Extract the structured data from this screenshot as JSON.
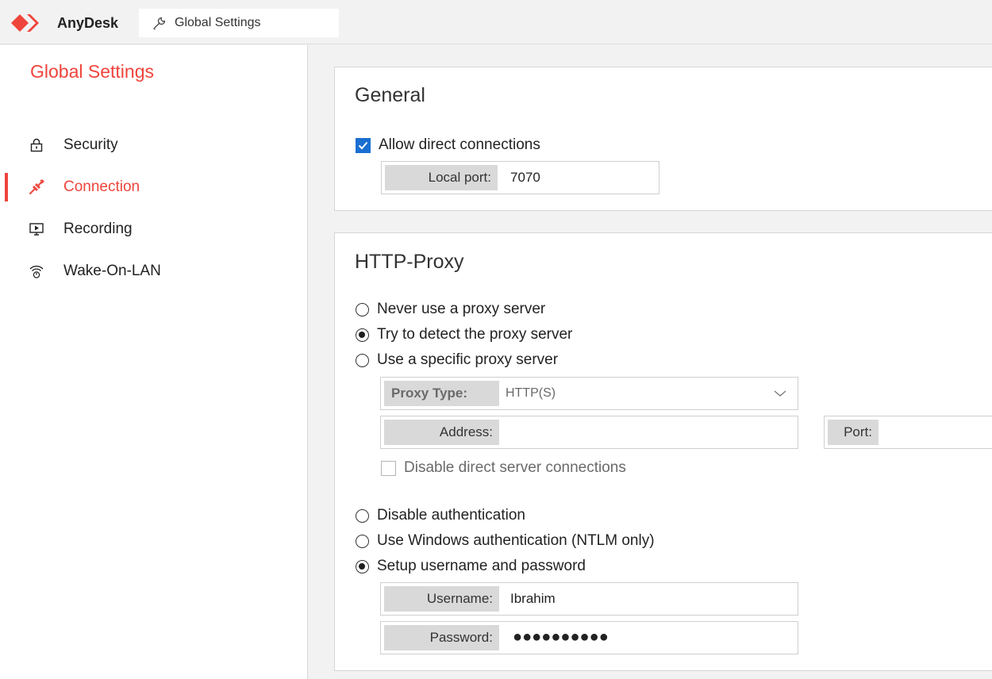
{
  "app": {
    "brand_name": "AnyDesk",
    "tab_label": "Global Settings",
    "accent_color": "#ef443b",
    "check_color": "#1a6fd1"
  },
  "sidebar": {
    "title": "Global Settings",
    "items": [
      {
        "label": "Security",
        "icon": "lock-icon",
        "active": false
      },
      {
        "label": "Connection",
        "icon": "connection-plug-icon",
        "active": true
      },
      {
        "label": "Recording",
        "icon": "monitor-play-icon",
        "active": false
      },
      {
        "label": "Wake-On-LAN",
        "icon": "wake-on-lan-icon",
        "active": false
      }
    ]
  },
  "general": {
    "title": "General",
    "allow_direct": {
      "label": "Allow direct connections",
      "checked": true
    },
    "local_port": {
      "label": "Local port:",
      "value": "7070"
    }
  },
  "proxy": {
    "title": "HTTP-Proxy",
    "mode_options": [
      {
        "label": "Never use a proxy server",
        "checked": false
      },
      {
        "label": "Try to detect the proxy server",
        "checked": true
      },
      {
        "label": "Use a specific proxy server",
        "checked": false
      }
    ],
    "proxy_type": {
      "label": "Proxy Type:",
      "value": "HTTP(S)"
    },
    "address": {
      "label": "Address:",
      "value": ""
    },
    "port": {
      "label": "Port:",
      "value": ""
    },
    "disable_direct_server": {
      "label": "Disable direct server connections",
      "checked": false
    },
    "auth_options": [
      {
        "label": "Disable authentication",
        "checked": false
      },
      {
        "label": "Use Windows authentication (NTLM only)",
        "checked": false
      },
      {
        "label": "Setup username and password",
        "checked": true
      }
    ],
    "username": {
      "label": "Username:",
      "value": "Ibrahim"
    },
    "password": {
      "label": "Password:",
      "value": "●●●●●●●●●●"
    }
  }
}
